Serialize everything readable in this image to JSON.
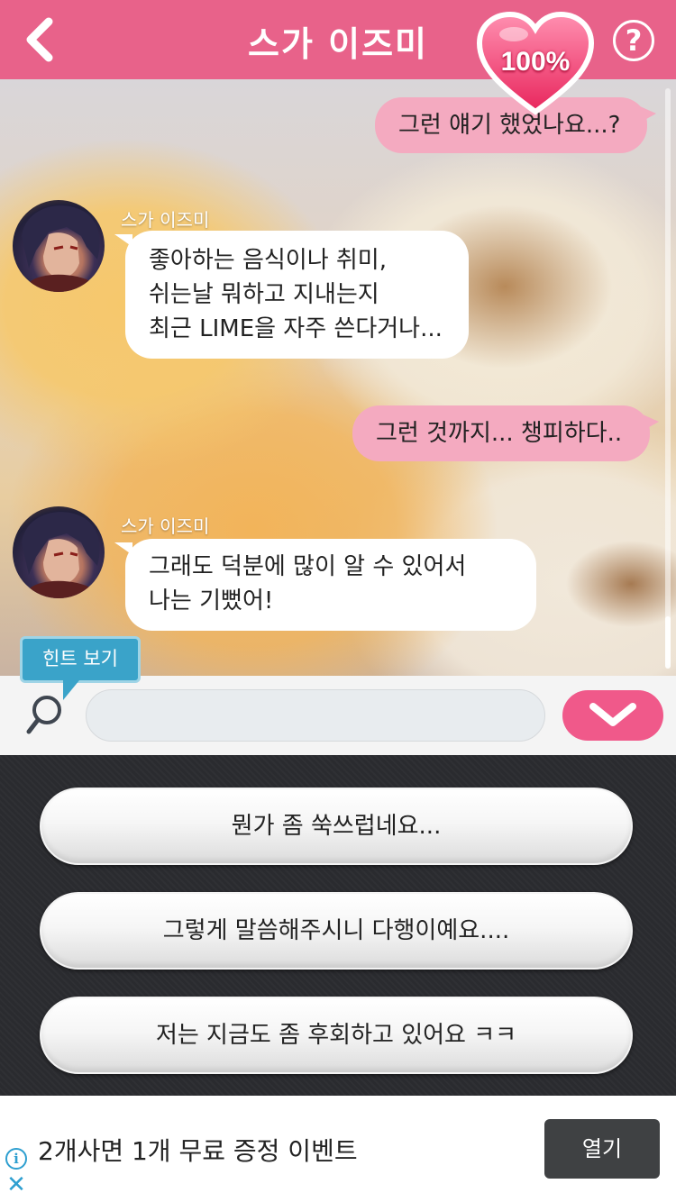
{
  "header": {
    "title": "스가 이즈미",
    "affection": "100%",
    "back_icon": "chevron-left-icon",
    "help_label": "?"
  },
  "messages": [
    {
      "side": "me",
      "text": "그런 얘기 했었나요...?"
    },
    {
      "side": "them",
      "speaker": "스가 이즈미",
      "lines": [
        "좋아하는 음식이나 취미,",
        "쉬는날 뭐하고 지내는지",
        "최근 LIME을 자주 쓴다거나..."
      ]
    },
    {
      "side": "me",
      "text": "그런 것까지... 챙피하다.."
    },
    {
      "side": "them",
      "speaker": "스가 이즈미",
      "lines": [
        "그래도 덕분에 많이 알 수 있어서",
        "나는 기뻤어!"
      ]
    }
  ],
  "input": {
    "hint_label": "힌트 보기",
    "value": "",
    "placeholder": ""
  },
  "choices": [
    "뭔가 좀 쑥쓰럽네요...",
    "그렇게 말씀해주시니 다행이예요....",
    "저는 지금도 좀 후회하고 있어요 ㅋㅋ"
  ],
  "ad": {
    "text": "2개사면 1개 무료 증정 이벤트",
    "button_label": "열기",
    "info_label": "i",
    "close_label": "✕"
  },
  "colors": {
    "header": "#e8628a",
    "my_bubble": "#f4aac0",
    "send_button": "#f0598a",
    "hint": "#3aa3c9"
  }
}
